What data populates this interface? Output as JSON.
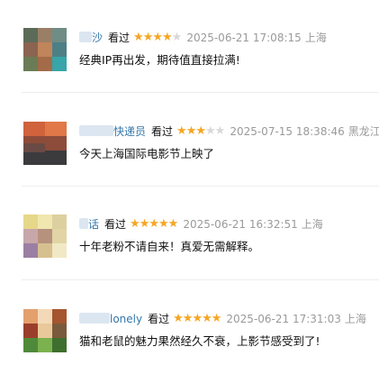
{
  "reviews": [
    {
      "user": "沙",
      "action": "看过",
      "rating": 4,
      "time": "2025-06-21 17:08:15",
      "location": "上海",
      "content": "经典IP再出发，期待值直接拉满!"
    },
    {
      "user": "快递员",
      "action": "看过",
      "rating": 3,
      "time": "2025-07-15 18:38:46",
      "location": "黑龙江",
      "content": "今天上海国际电影节上映了"
    },
    {
      "user": "话",
      "action": "看过",
      "rating": 5,
      "time": "2025-06-21 16:32:51",
      "location": "上海",
      "content": "十年老粉不请自来！真爱无需解释。"
    },
    {
      "user": "lonely",
      "action": "看过",
      "rating": 5,
      "time": "2025-06-21 17:31:03",
      "location": "上海",
      "content": "猫和老鼠的魅力果然经久不衰，上影节感受到了!"
    }
  ],
  "colors": {
    "star_on": "#f5a623",
    "star_off": "#d8d8d8",
    "username": "#3377aa",
    "meta": "#9a9a9a"
  }
}
